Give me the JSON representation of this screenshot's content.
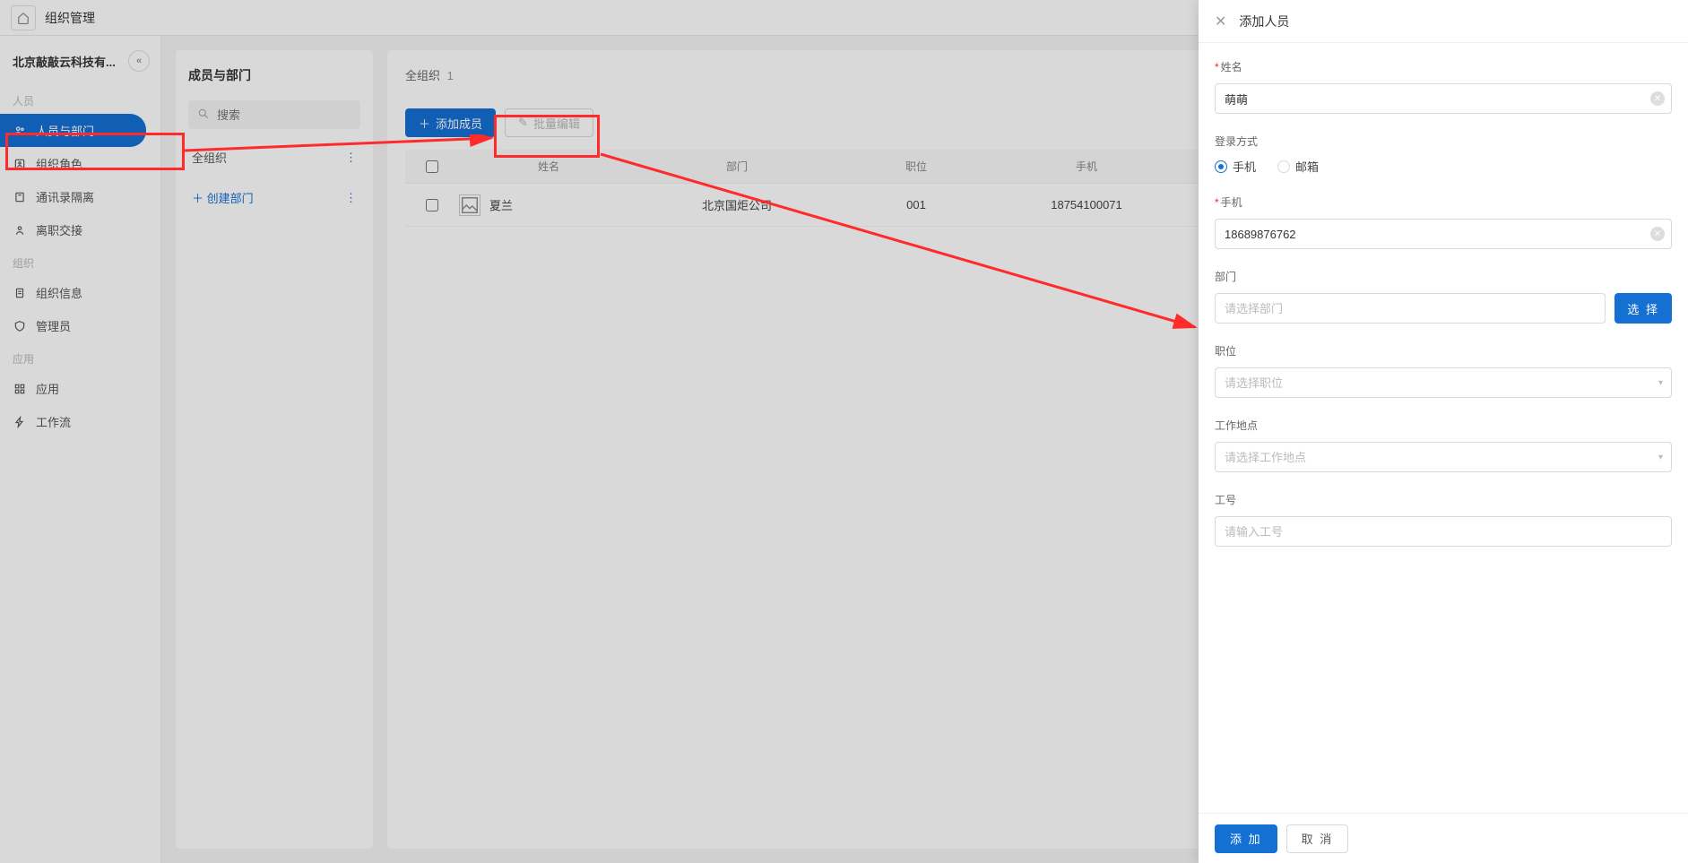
{
  "header": {
    "title": "组织管理"
  },
  "org": {
    "name": "北京敲敲云科技有..."
  },
  "sidebar": {
    "sections": {
      "people": {
        "label": "人员",
        "items": [
          {
            "label": "人员与部门"
          },
          {
            "label": "组织角色"
          },
          {
            "label": "通讯录隔离"
          },
          {
            "label": "离职交接"
          }
        ]
      },
      "org": {
        "label": "组织",
        "items": [
          {
            "label": "组织信息"
          },
          {
            "label": "管理员"
          }
        ]
      },
      "app": {
        "label": "应用",
        "items": [
          {
            "label": "应用"
          },
          {
            "label": "工作流"
          }
        ]
      }
    }
  },
  "dept_panel": {
    "title": "成员与部门",
    "search_placeholder": "搜索",
    "root": "全组织",
    "create_label": "创建部门"
  },
  "table": {
    "breadcrumb": "全组织",
    "count": "1",
    "add_member": "添加成员",
    "batch_edit": "批量编辑",
    "columns": {
      "name": "姓名",
      "dept": "部门",
      "pos": "职位",
      "phone": "手机"
    },
    "rows": [
      {
        "name": "夏兰",
        "dept": "北京国炬公司",
        "pos": "001",
        "phone": "18754100071"
      }
    ]
  },
  "drawer": {
    "title": "添加人员",
    "fields": {
      "name": {
        "label": "姓名",
        "value": "萌萌"
      },
      "login_method": {
        "label": "登录方式",
        "phone": "手机",
        "email": "邮箱"
      },
      "phone": {
        "label": "手机",
        "value": "18689876762"
      },
      "dept": {
        "label": "部门",
        "placeholder": "请选择部门",
        "select_btn": "选 择"
      },
      "pos": {
        "label": "职位",
        "placeholder": "请选择职位"
      },
      "location": {
        "label": "工作地点",
        "placeholder": "请选择工作地点"
      },
      "empno": {
        "label": "工号",
        "placeholder": "请输入工号"
      }
    },
    "footer": {
      "submit": "添 加",
      "cancel": "取 消"
    }
  }
}
